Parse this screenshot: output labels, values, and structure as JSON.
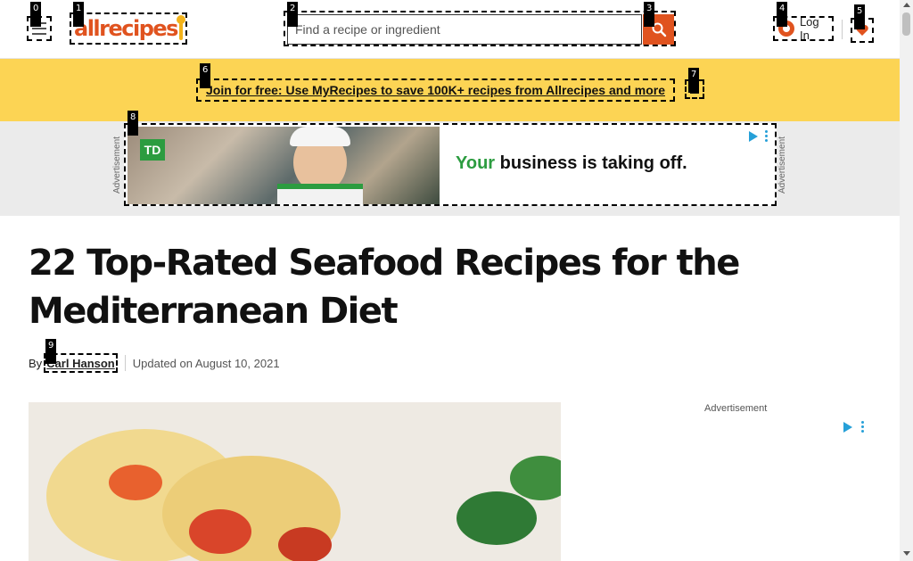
{
  "header": {
    "logo_text": "allrecipes",
    "search": {
      "placeholder": "Find a recipe or ingredient"
    },
    "login_label": "Log In"
  },
  "promo": {
    "text": "Join for free: Use MyRecipes to save 100K+ recipes from Allrecipes and more"
  },
  "ad_banner": {
    "label": "Advertisement",
    "brand": "TD",
    "headline_accent": "Your",
    "headline_rest": " business is taking off."
  },
  "article": {
    "title": "22 Top-Rated Seafood Recipes for the Mediterranean Diet",
    "byline_prefix": "By",
    "author": "Carl Hanson",
    "updated": "Updated on August 10, 2021"
  },
  "side_ad": {
    "label": "Advertisement"
  },
  "markers": [
    "0",
    "1",
    "2",
    "3",
    "4",
    "5",
    "6",
    "7",
    "8",
    "9"
  ],
  "colors": {
    "brand": "#e0531f",
    "promo_bg": "#fcd454",
    "ad_green": "#2c9c40",
    "ad_choices": "#26a0d8"
  },
  "icons": {
    "menu": "hamburger-menu-icon",
    "search": "magnifier-search-icon",
    "login": "user-circle-icon",
    "favorites": "heart-icon",
    "close": "close-icon",
    "ad_choices": "ad-choices-icon",
    "kebab": "kebab-menu-icon"
  }
}
